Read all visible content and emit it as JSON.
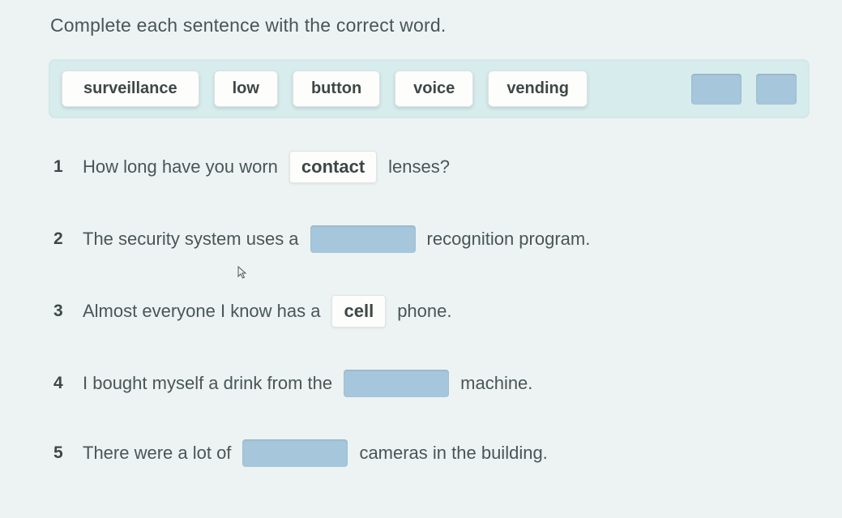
{
  "instruction": "Complete each sentence with the correct word.",
  "word_bank": {
    "tiles": [
      "surveillance",
      "low",
      "button",
      "voice",
      "vending"
    ]
  },
  "questions": [
    {
      "num": "1",
      "before": "How long have you worn",
      "answer": "contact",
      "after": "lenses?",
      "filled": true
    },
    {
      "num": "2",
      "before": "The security system uses a",
      "answer": "",
      "after": "recognition program.",
      "filled": false
    },
    {
      "num": "3",
      "before": "Almost everyone I know has a",
      "answer": "cell",
      "after": "phone.",
      "filled": true
    },
    {
      "num": "4",
      "before": "I bought myself a drink from the",
      "answer": "",
      "after": "machine.",
      "filled": false
    },
    {
      "num": "5",
      "before": "There were a lot of",
      "answer": "",
      "after": "cameras in the building.",
      "filled": false
    }
  ]
}
